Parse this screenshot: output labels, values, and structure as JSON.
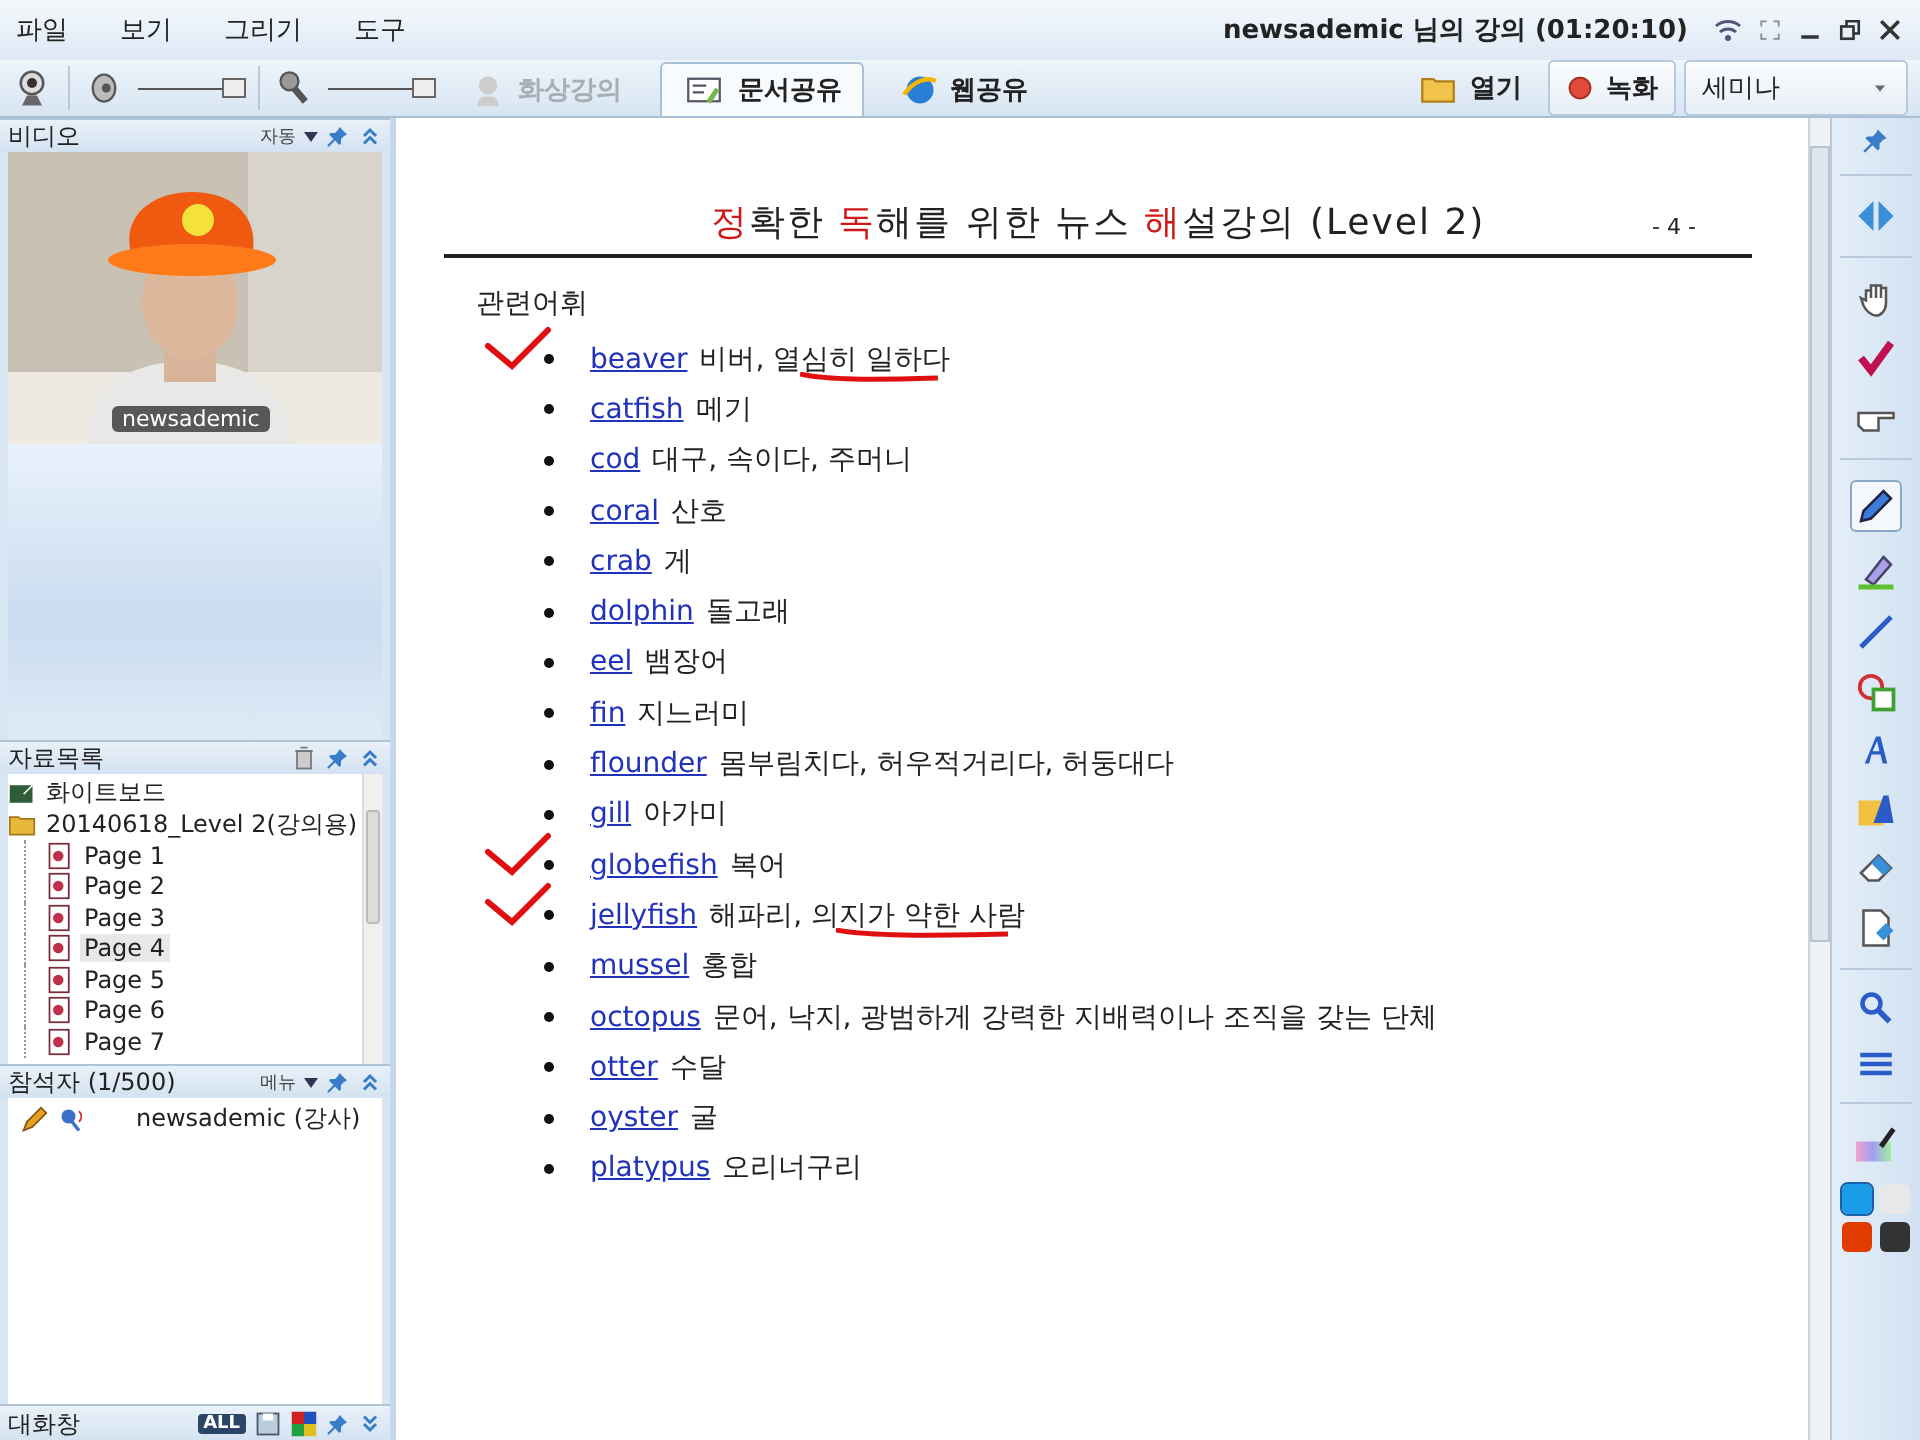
{
  "menu": [
    "파일",
    "보기",
    "그리기",
    "도구"
  ],
  "window": {
    "title": "newsademic 님의 강의 (01:20:10)"
  },
  "toolbar": {
    "tabs": [
      {
        "label": "화상강의",
        "selected": false,
        "disabled": true
      },
      {
        "label": "문서공유",
        "selected": true,
        "disabled": false
      },
      {
        "label": "웹공유",
        "selected": false,
        "disabled": false
      }
    ],
    "speaker_volume": {
      "level": 1
    },
    "mic_volume": {
      "level": 1
    },
    "open_label": "열기",
    "record_label": "녹화",
    "mode": "세미나"
  },
  "video_panel": {
    "title": "비디오",
    "mode": "자동",
    "name_tag": "newsademic"
  },
  "files_panel": {
    "title": "자료목록",
    "items": [
      {
        "label": "화이트보드",
        "kind": "board",
        "selected": false
      },
      {
        "label": "20140618_Level 2(강의용)",
        "kind": "folder",
        "selected": false,
        "children": [
          {
            "label": "Page 1",
            "kind": "page",
            "selected": false
          },
          {
            "label": "Page 2",
            "kind": "page",
            "selected": false
          },
          {
            "label": "Page 3",
            "kind": "page",
            "selected": false
          },
          {
            "label": "Page 4",
            "kind": "page",
            "selected": true
          },
          {
            "label": "Page 5",
            "kind": "page",
            "selected": false
          },
          {
            "label": "Page 6",
            "kind": "page",
            "selected": false
          },
          {
            "label": "Page 7",
            "kind": "page",
            "selected": false
          }
        ]
      }
    ]
  },
  "participants_panel": {
    "title": "참석자 (1/500)",
    "menu": "메뉴",
    "items": [
      {
        "name": "newsademic (강사)"
      }
    ]
  },
  "chat_panel": {
    "title": "대화창",
    "filter": "ALL"
  },
  "document": {
    "title": [
      {
        "text": "정",
        "highlight": true
      },
      {
        "text": "확한 ",
        "highlight": false
      },
      {
        "text": "독",
        "highlight": true
      },
      {
        "text": "해를 위한 뉴스 ",
        "highlight": false
      },
      {
        "text": "해",
        "highlight": true
      },
      {
        "text": "설강의 (Level 2)",
        "highlight": false
      }
    ],
    "page_number": "- 4 -",
    "section": "관련어휘",
    "vocab": [
      {
        "word": "beaver",
        "meaning": "비버, 열심히 일하다",
        "checked": true,
        "underlined": true
      },
      {
        "word": "catfish",
        "meaning": "메기",
        "checked": false,
        "underlined": false
      },
      {
        "word": "cod",
        "meaning": "대구, 속이다, 주머니",
        "checked": false,
        "underlined": false
      },
      {
        "word": "coral",
        "meaning": "산호",
        "checked": false,
        "underlined": false
      },
      {
        "word": "crab",
        "meaning": "게",
        "checked": false,
        "underlined": false
      },
      {
        "word": "dolphin",
        "meaning": "돌고래",
        "checked": false,
        "underlined": false
      },
      {
        "word": "eel",
        "meaning": "뱀장어",
        "checked": false,
        "underlined": false
      },
      {
        "word": "fin",
        "meaning": "지느러미",
        "checked": false,
        "underlined": false
      },
      {
        "word": "flounder",
        "meaning": "몸부림치다, 허우적거리다, 허둥대다",
        "checked": false,
        "underlined": false
      },
      {
        "word": "gill",
        "meaning": "아가미",
        "checked": false,
        "underlined": false
      },
      {
        "word": "globefish",
        "meaning": "복어",
        "checked": true,
        "underlined": false
      },
      {
        "word": "jellyfish",
        "meaning": "해파리, 의지가 약한 사람",
        "checked": true,
        "underlined": true
      },
      {
        "word": "mussel",
        "meaning": "홍합",
        "checked": false,
        "underlined": false
      },
      {
        "word": "octopus",
        "meaning": "문어, 낙지, 광범하게 강력한 지배력이나 조직을 갖는 단체",
        "checked": false,
        "underlined": false
      },
      {
        "word": "otter",
        "meaning": "수달",
        "checked": false,
        "underlined": false
      },
      {
        "word": "oyster",
        "meaning": "굴",
        "checked": false,
        "underlined": false
      },
      {
        "word": "platypus",
        "meaning": "오리너구리",
        "checked": false,
        "underlined": false
      }
    ]
  },
  "colors": [
    {
      "color": "#1a9be8",
      "selected": true
    },
    {
      "color": "#e8e8e8",
      "selected": false
    },
    {
      "color": "#e03c00",
      "selected": false
    },
    {
      "color": "#333333",
      "selected": false
    }
  ]
}
